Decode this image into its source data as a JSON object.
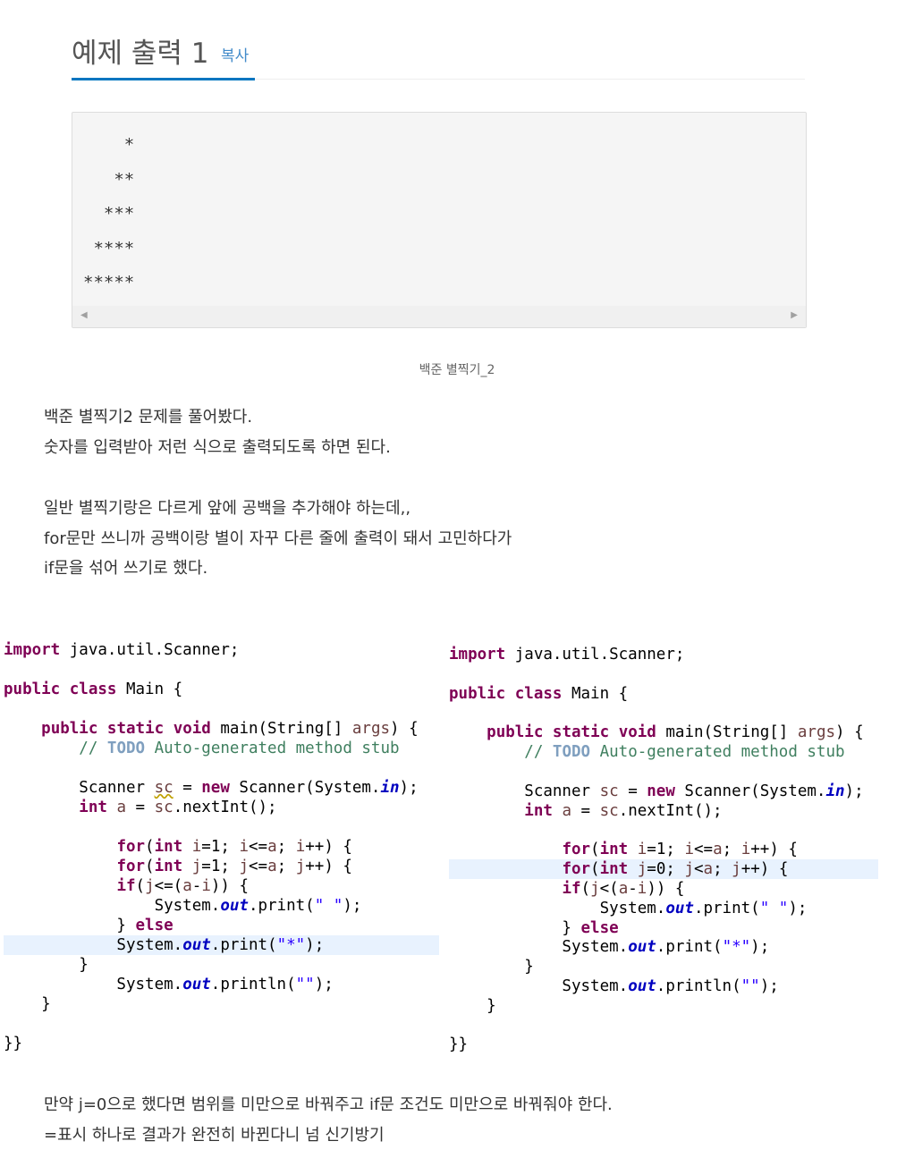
{
  "sample": {
    "title": "예제 출력 1",
    "copy_label": "복사",
    "output_lines": [
      "    *",
      "   **",
      "  ***",
      " ****",
      "*****"
    ]
  },
  "caption": "백준 별찍기_2",
  "paragraph1": [
    "백준 별찍기2 문제를 풀어봤다.",
    "숫자를 입력받아 저런 식으로 출력되도록 하면 된다."
  ],
  "paragraph2": [
    "일반 별찍기랑은 다르게 앞에 공백을 추가해야 하는데,,",
    "for문만 쓰니까 공백이랑 별이 자꾸 다른 줄에 출력이 돼서 고민하다가",
    "if문을 섞어 쓰기로 했다."
  ],
  "code_left_text": [
    "import java.util.Scanner;",
    "public class Main {",
    "public static void main(String[] args) {",
    "// TODO Auto-generated method stub",
    "Scanner sc = new Scanner(System.in);",
    "int a = sc.nextInt();",
    "for(int i=1; i<=a; i++) {",
    "for(int j=1; j<=a; j++) {",
    "if(j<=(a-i)) {",
    "System.out.print(\" \");",
    "} else",
    "System.out.print(\"*\");",
    "}",
    "System.out.println(\"\");",
    "}",
    "}}"
  ],
  "code_right_text": [
    "import java.util.Scanner;",
    "public class Main {",
    "public static void main(String[] args) {",
    "// TODO Auto-generated method stub",
    "Scanner sc = new Scanner(System.in);",
    "int a = sc.nextInt();",
    "for(int i=1; i<=a; i++) {",
    "for(int j=0; j<a; j++) {",
    "if(j<(a-i)) {",
    "System.out.print(\" \");",
    "} else",
    "System.out.print(\"*\");",
    "}",
    "System.out.println(\"\");",
    "}",
    "}}"
  ],
  "paragraph3": [
    "만약 j=0으로 했다면 범위를 미만으로 바꿔주고 if문 조건도 미만으로 바꿔줘야 한다.",
    "=표시 하나로 결과가 완전히 바뀐다니 넘 신기방기"
  ]
}
